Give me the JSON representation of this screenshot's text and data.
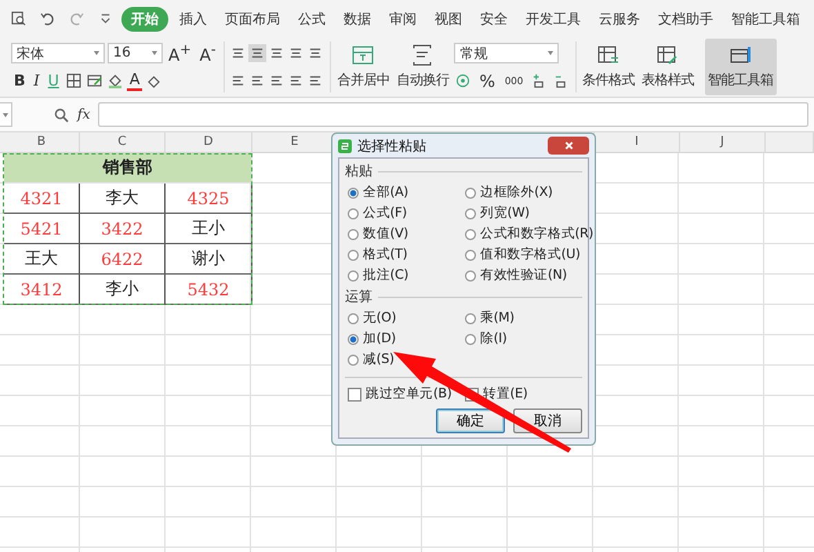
{
  "tabs": [
    {
      "label": "开始",
      "selected": true
    },
    {
      "label": "插入",
      "selected": false
    },
    {
      "label": "页面布局",
      "selected": false
    },
    {
      "label": "公式",
      "selected": false
    },
    {
      "label": "数据",
      "selected": false
    },
    {
      "label": "审阅",
      "selected": false
    },
    {
      "label": "视图",
      "selected": false
    },
    {
      "label": "安全",
      "selected": false
    },
    {
      "label": "开发工具",
      "selected": false
    },
    {
      "label": "云服务",
      "selected": false
    },
    {
      "label": "文档助手",
      "selected": false
    },
    {
      "label": "智能工具箱",
      "selected": false
    }
  ],
  "toolbar": {
    "font": {
      "value": "宋体"
    },
    "size": {
      "value": "16"
    },
    "grow_font": "A$^{+}$",
    "shrink_font": "A$^{-}$",
    "bold": "B",
    "italic": "I",
    "underline": "U",
    "font_color": "A",
    "merge": {
      "label": "合并居中"
    },
    "wrap": {
      "label": "自动换行"
    },
    "number_format": {
      "value": "常规"
    },
    "percent": "%",
    "thousands": "000",
    "conditional": {
      "label": "条件格式"
    },
    "table_style": {
      "label": "表格样式"
    },
    "smart_toolbox": {
      "label": "智能工具箱",
      "active": true
    }
  },
  "formula_bar": {
    "fx": "fx"
  },
  "sheet": {
    "columns": [
      {
        "label": "B"
      },
      {
        "label": "C"
      },
      {
        "label": "D"
      },
      {
        "label": "E"
      },
      {
        "label": "I"
      },
      {
        "label": "J"
      }
    ],
    "rows": [
      {
        "kind": "merged",
        "text": "销售部"
      },
      {
        "kind": "data",
        "cells": [
          {
            "text": "4321",
            "color": "#ff3b3b"
          },
          {
            "text": "李大",
            "color": "#222222"
          },
          {
            "text": "4325",
            "color": "#ff3b3b"
          }
        ]
      },
      {
        "kind": "data",
        "cells": [
          {
            "text": "5421",
            "color": "#ff3b3b"
          },
          {
            "text": "3422",
            "color": "#ff3b3b"
          },
          {
            "text": "王小",
            "color": "#222222"
          }
        ]
      },
      {
        "kind": "data",
        "cells": [
          {
            "text": "王大",
            "color": "#222222"
          },
          {
            "text": "6422",
            "color": "#ff3b3b"
          },
          {
            "text": "谢小",
            "color": "#222222"
          }
        ]
      },
      {
        "kind": "data",
        "cells": [
          {
            "text": "3412",
            "color": "#ff3b3b"
          },
          {
            "text": "李小",
            "color": "#222222"
          },
          {
            "text": "5432",
            "color": "#ff3b3b"
          }
        ]
      }
    ]
  },
  "dialog": {
    "title": "选择性粘贴",
    "paste": {
      "title": "粘贴",
      "options": [
        {
          "label": "全部(A)",
          "selected": true
        },
        {
          "label": "边框除外(X)",
          "selected": false
        },
        {
          "label": "公式(F)",
          "selected": false
        },
        {
          "label": "列宽(W)",
          "selected": false
        },
        {
          "label": "数值(V)",
          "selected": false
        },
        {
          "label": "公式和数字格式(R)",
          "selected": false
        },
        {
          "label": "格式(T)",
          "selected": false
        },
        {
          "label": "值和数字格式(U)",
          "selected": false
        },
        {
          "label": "批注(C)",
          "selected": false
        },
        {
          "label": "有效性验证(N)",
          "selected": false
        }
      ]
    },
    "operation": {
      "title": "运算",
      "options": [
        {
          "label": "无(O)",
          "selected": false
        },
        {
          "label": "乘(M)",
          "selected": false
        },
        {
          "label": "加(D)",
          "selected": true
        },
        {
          "label": "除(I)",
          "selected": false
        },
        {
          "label": "减(S)",
          "selected": false
        }
      ]
    },
    "checkboxes": [
      {
        "label": "跳过空单元(B)",
        "checked": false
      },
      {
        "label": "转置(E)",
        "checked": false
      }
    ],
    "buttons": [
      {
        "label": "确定",
        "default": true
      },
      {
        "label": "取消",
        "default": false
      }
    ]
  }
}
